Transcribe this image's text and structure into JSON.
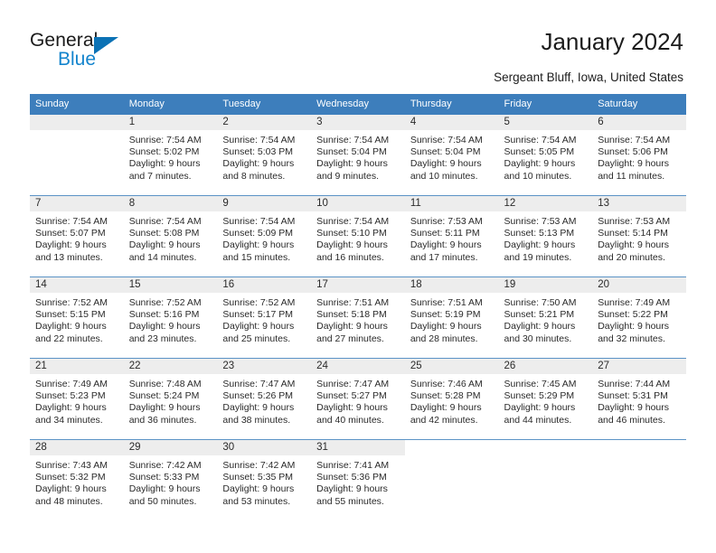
{
  "brand": {
    "name_top": "General",
    "name_bottom": "Blue",
    "accent_color": "#1384cd",
    "triangle_color": "#0b72b5"
  },
  "header": {
    "title": "January 2024",
    "location": "Sergeant Bluff, Iowa, United States"
  },
  "theme": {
    "header_blue": "#3d7ebc",
    "daynum_band": "#ededed",
    "row_line": "#5b93c6"
  },
  "calendar": {
    "weekdays": [
      "Sunday",
      "Monday",
      "Tuesday",
      "Wednesday",
      "Thursday",
      "Friday",
      "Saturday"
    ],
    "labels": {
      "sunrise": "Sunrise:",
      "sunset": "Sunset:",
      "daylight": "Daylight:"
    },
    "weeks": [
      [
        {
          "day": "",
          "sunrise": "",
          "sunset": "",
          "daylight1": "",
          "daylight2": ""
        },
        {
          "day": "1",
          "sunrise": "Sunrise: 7:54 AM",
          "sunset": "Sunset: 5:02 PM",
          "daylight1": "Daylight: 9 hours",
          "daylight2": "and 7 minutes."
        },
        {
          "day": "2",
          "sunrise": "Sunrise: 7:54 AM",
          "sunset": "Sunset: 5:03 PM",
          "daylight1": "Daylight: 9 hours",
          "daylight2": "and 8 minutes."
        },
        {
          "day": "3",
          "sunrise": "Sunrise: 7:54 AM",
          "sunset": "Sunset: 5:04 PM",
          "daylight1": "Daylight: 9 hours",
          "daylight2": "and 9 minutes."
        },
        {
          "day": "4",
          "sunrise": "Sunrise: 7:54 AM",
          "sunset": "Sunset: 5:04 PM",
          "daylight1": "Daylight: 9 hours",
          "daylight2": "and 10 minutes."
        },
        {
          "day": "5",
          "sunrise": "Sunrise: 7:54 AM",
          "sunset": "Sunset: 5:05 PM",
          "daylight1": "Daylight: 9 hours",
          "daylight2": "and 10 minutes."
        },
        {
          "day": "6",
          "sunrise": "Sunrise: 7:54 AM",
          "sunset": "Sunset: 5:06 PM",
          "daylight1": "Daylight: 9 hours",
          "daylight2": "and 11 minutes."
        }
      ],
      [
        {
          "day": "7",
          "sunrise": "Sunrise: 7:54 AM",
          "sunset": "Sunset: 5:07 PM",
          "daylight1": "Daylight: 9 hours",
          "daylight2": "and 13 minutes."
        },
        {
          "day": "8",
          "sunrise": "Sunrise: 7:54 AM",
          "sunset": "Sunset: 5:08 PM",
          "daylight1": "Daylight: 9 hours",
          "daylight2": "and 14 minutes."
        },
        {
          "day": "9",
          "sunrise": "Sunrise: 7:54 AM",
          "sunset": "Sunset: 5:09 PM",
          "daylight1": "Daylight: 9 hours",
          "daylight2": "and 15 minutes."
        },
        {
          "day": "10",
          "sunrise": "Sunrise: 7:54 AM",
          "sunset": "Sunset: 5:10 PM",
          "daylight1": "Daylight: 9 hours",
          "daylight2": "and 16 minutes."
        },
        {
          "day": "11",
          "sunrise": "Sunrise: 7:53 AM",
          "sunset": "Sunset: 5:11 PM",
          "daylight1": "Daylight: 9 hours",
          "daylight2": "and 17 minutes."
        },
        {
          "day": "12",
          "sunrise": "Sunrise: 7:53 AM",
          "sunset": "Sunset: 5:13 PM",
          "daylight1": "Daylight: 9 hours",
          "daylight2": "and 19 minutes."
        },
        {
          "day": "13",
          "sunrise": "Sunrise: 7:53 AM",
          "sunset": "Sunset: 5:14 PM",
          "daylight1": "Daylight: 9 hours",
          "daylight2": "and 20 minutes."
        }
      ],
      [
        {
          "day": "14",
          "sunrise": "Sunrise: 7:52 AM",
          "sunset": "Sunset: 5:15 PM",
          "daylight1": "Daylight: 9 hours",
          "daylight2": "and 22 minutes."
        },
        {
          "day": "15",
          "sunrise": "Sunrise: 7:52 AM",
          "sunset": "Sunset: 5:16 PM",
          "daylight1": "Daylight: 9 hours",
          "daylight2": "and 23 minutes."
        },
        {
          "day": "16",
          "sunrise": "Sunrise: 7:52 AM",
          "sunset": "Sunset: 5:17 PM",
          "daylight1": "Daylight: 9 hours",
          "daylight2": "and 25 minutes."
        },
        {
          "day": "17",
          "sunrise": "Sunrise: 7:51 AM",
          "sunset": "Sunset: 5:18 PM",
          "daylight1": "Daylight: 9 hours",
          "daylight2": "and 27 minutes."
        },
        {
          "day": "18",
          "sunrise": "Sunrise: 7:51 AM",
          "sunset": "Sunset: 5:19 PM",
          "daylight1": "Daylight: 9 hours",
          "daylight2": "and 28 minutes."
        },
        {
          "day": "19",
          "sunrise": "Sunrise: 7:50 AM",
          "sunset": "Sunset: 5:21 PM",
          "daylight1": "Daylight: 9 hours",
          "daylight2": "and 30 minutes."
        },
        {
          "day": "20",
          "sunrise": "Sunrise: 7:49 AM",
          "sunset": "Sunset: 5:22 PM",
          "daylight1": "Daylight: 9 hours",
          "daylight2": "and 32 minutes."
        }
      ],
      [
        {
          "day": "21",
          "sunrise": "Sunrise: 7:49 AM",
          "sunset": "Sunset: 5:23 PM",
          "daylight1": "Daylight: 9 hours",
          "daylight2": "and 34 minutes."
        },
        {
          "day": "22",
          "sunrise": "Sunrise: 7:48 AM",
          "sunset": "Sunset: 5:24 PM",
          "daylight1": "Daylight: 9 hours",
          "daylight2": "and 36 minutes."
        },
        {
          "day": "23",
          "sunrise": "Sunrise: 7:47 AM",
          "sunset": "Sunset: 5:26 PM",
          "daylight1": "Daylight: 9 hours",
          "daylight2": "and 38 minutes."
        },
        {
          "day": "24",
          "sunrise": "Sunrise: 7:47 AM",
          "sunset": "Sunset: 5:27 PM",
          "daylight1": "Daylight: 9 hours",
          "daylight2": "and 40 minutes."
        },
        {
          "day": "25",
          "sunrise": "Sunrise: 7:46 AM",
          "sunset": "Sunset: 5:28 PM",
          "daylight1": "Daylight: 9 hours",
          "daylight2": "and 42 minutes."
        },
        {
          "day": "26",
          "sunrise": "Sunrise: 7:45 AM",
          "sunset": "Sunset: 5:29 PM",
          "daylight1": "Daylight: 9 hours",
          "daylight2": "and 44 minutes."
        },
        {
          "day": "27",
          "sunrise": "Sunrise: 7:44 AM",
          "sunset": "Sunset: 5:31 PM",
          "daylight1": "Daylight: 9 hours",
          "daylight2": "and 46 minutes."
        }
      ],
      [
        {
          "day": "28",
          "sunrise": "Sunrise: 7:43 AM",
          "sunset": "Sunset: 5:32 PM",
          "daylight1": "Daylight: 9 hours",
          "daylight2": "and 48 minutes."
        },
        {
          "day": "29",
          "sunrise": "Sunrise: 7:42 AM",
          "sunset": "Sunset: 5:33 PM",
          "daylight1": "Daylight: 9 hours",
          "daylight2": "and 50 minutes."
        },
        {
          "day": "30",
          "sunrise": "Sunrise: 7:42 AM",
          "sunset": "Sunset: 5:35 PM",
          "daylight1": "Daylight: 9 hours",
          "daylight2": "and 53 minutes."
        },
        {
          "day": "31",
          "sunrise": "Sunrise: 7:41 AM",
          "sunset": "Sunset: 5:36 PM",
          "daylight1": "Daylight: 9 hours",
          "daylight2": "and 55 minutes."
        },
        {
          "day": "",
          "sunrise": "",
          "sunset": "",
          "daylight1": "",
          "daylight2": ""
        },
        {
          "day": "",
          "sunrise": "",
          "sunset": "",
          "daylight1": "",
          "daylight2": ""
        },
        {
          "day": "",
          "sunrise": "",
          "sunset": "",
          "daylight1": "",
          "daylight2": ""
        }
      ]
    ]
  }
}
